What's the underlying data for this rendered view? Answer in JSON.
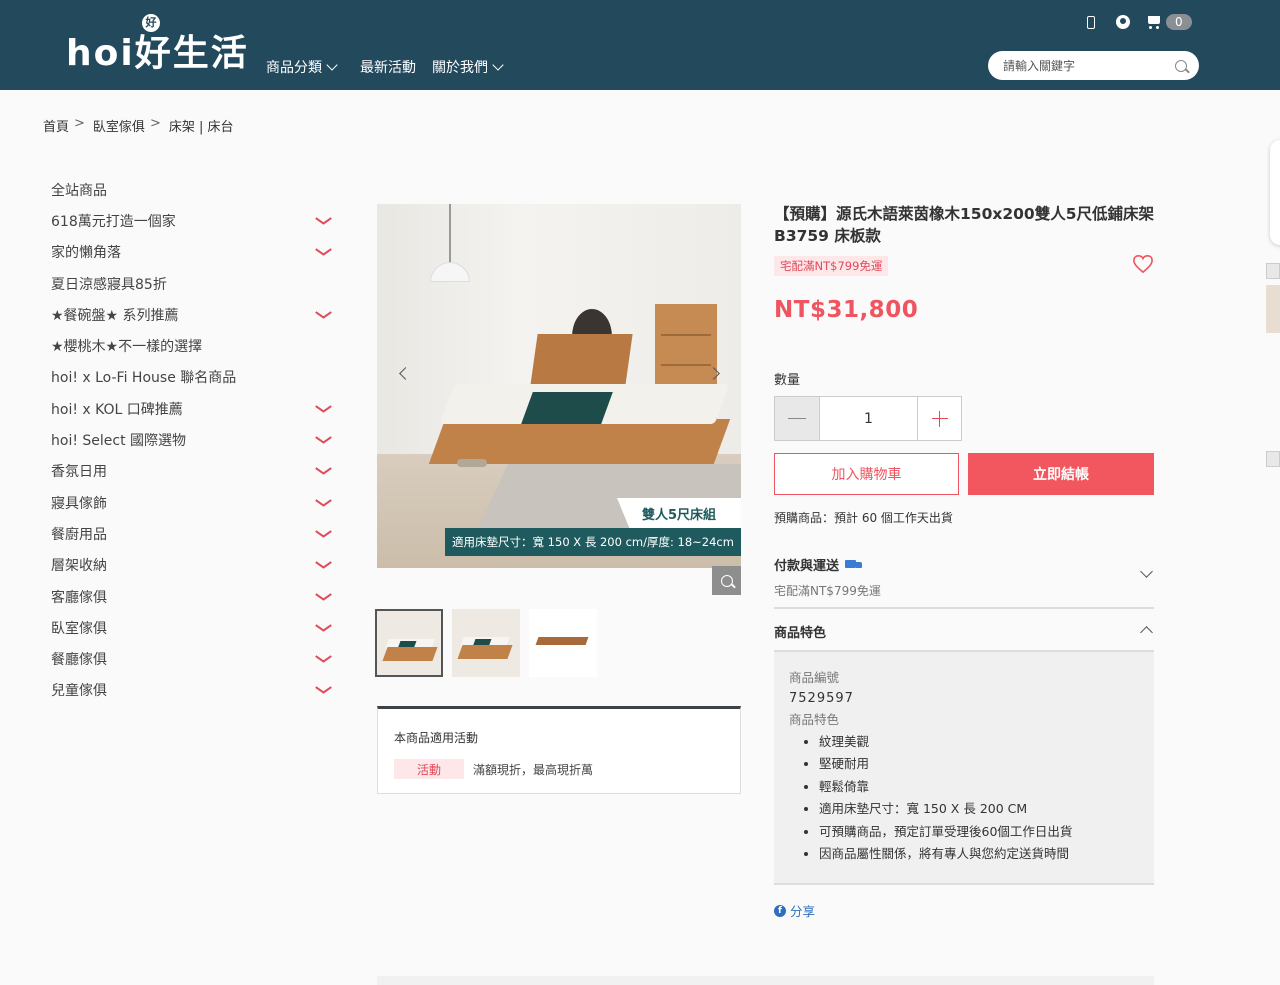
{
  "header": {
    "logo_text": "hoi好生活",
    "logo_badge": "好",
    "nav": [
      {
        "label": "商品分類",
        "has_dropdown": true
      },
      {
        "label": "最新活動",
        "has_dropdown": false
      },
      {
        "label": "關於我們",
        "has_dropdown": true
      }
    ],
    "cart_count": "0",
    "search_placeholder": "請輸入關鍵字",
    "icons": [
      "phone-icon",
      "user-icon",
      "cart-icon",
      "search-icon"
    ]
  },
  "breadcrumb": [
    "首頁",
    "臥室傢俱",
    "床架 | 床台"
  ],
  "breadcrumb_sep": ">",
  "sidebar": [
    {
      "label": "全站商品",
      "expandable": false
    },
    {
      "label": "618萬元打造一個家",
      "expandable": true
    },
    {
      "label": "家的懶角落",
      "expandable": true
    },
    {
      "label": "夏日涼感寢具85折",
      "expandable": false
    },
    {
      "label": "★餐碗盤★ 系列推薦",
      "expandable": true
    },
    {
      "label": "★櫻桃木★不一樣的選擇",
      "expandable": false
    },
    {
      "label": "hoi! x Lo-Fi House 聯名商品",
      "expandable": false
    },
    {
      "label": "hoi! x KOL 口碑推薦",
      "expandable": true
    },
    {
      "label": "hoi! Select 國際選物",
      "expandable": true
    },
    {
      "label": "香氛日用",
      "expandable": true
    },
    {
      "label": "寢具傢飾",
      "expandable": true
    },
    {
      "label": "餐廚用品",
      "expandable": true
    },
    {
      "label": "層架收納",
      "expandable": true
    },
    {
      "label": "客廳傢俱",
      "expandable": true
    },
    {
      "label": "臥室傢俱",
      "expandable": true
    },
    {
      "label": "餐廳傢俱",
      "expandable": true
    },
    {
      "label": "兒童傢俱",
      "expandable": true
    }
  ],
  "gallery": {
    "overlay_tag": "雙人5尺床組",
    "overlay_size": "適用床墊尺寸：寬 150 X 長 200 cm/厚度: 18~24cm",
    "thumbnail_count": 3,
    "active_thumbnail": 0
  },
  "promo": {
    "title": "本商品適用活動",
    "tag": "活動",
    "text": "滿額現折，最高現折萬"
  },
  "product": {
    "title": "【預購】源氏木語萊茵橡木150x200雙人5尺低鋪床架B3759 床板款",
    "shipping_badge": "宅配滿NT$799免運",
    "price": "NT$31,800",
    "quantity_label": "數量",
    "quantity": "1",
    "add_to_cart": "加入購物車",
    "buy_now": "立即結帳",
    "preorder_note": "預購商品：預計 60 個工作天出貨",
    "payment_shipping_title": "付款與運送",
    "payment_shipping_sub": "宅配滿NT$799免運",
    "features_title": "商品特色",
    "sku_label": "商品編號",
    "sku": "7529597",
    "features_label": "商品特色",
    "features": [
      "紋理美觀",
      "堅硬耐用",
      "輕鬆倚靠",
      "適用床墊尺寸：寬 150 X 長 200 CM",
      "可預購商品，預定訂單受理後60個工作日出貨",
      "因商品屬性關係，將有專人與您約定送貨時間"
    ],
    "share": "分享"
  },
  "colors": {
    "header_bg": "#23495c",
    "accent": "#ef5560",
    "link": "#2f6fbf"
  }
}
